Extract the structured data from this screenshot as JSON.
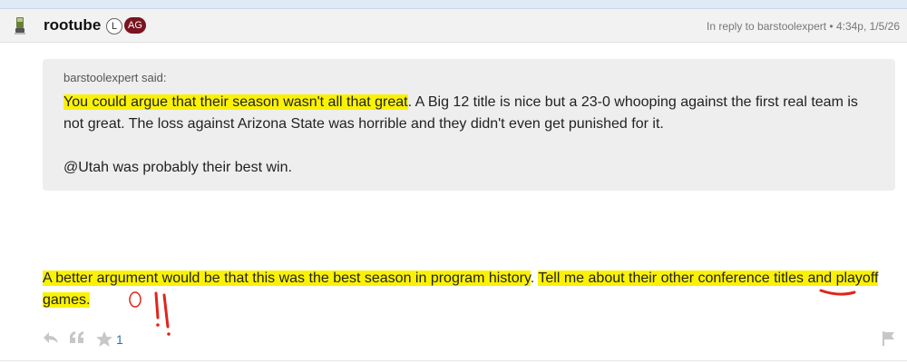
{
  "post": {
    "username": "rootube",
    "badges": [
      "L",
      "AG"
    ],
    "reply_meta": "In reply to barstoolexpert • 4:34p, 1/5/26",
    "quote": {
      "author_line": "barstoolexpert said:",
      "highlighted": "You could argue that their season wasn't all that great",
      "rest": ". A Big 12 title is nice but a 23-0 whooping against the first real team is not great. The loss against Arizona State was horrible and they didn't even get punished for it.",
      "p2": "@Utah was probably their best win."
    },
    "reply": {
      "hl1": "A better argument would be that this was the best season in program history",
      "mid": ". ",
      "hl2": "Tell me about their other conference titles and playoff games.",
      "after": ""
    },
    "like_count": "1",
    "annotation": "!!"
  },
  "icons": [
    "reply-icon",
    "quote-icon",
    "star-icon",
    "flag-icon",
    "avatar-icon"
  ],
  "colors": {
    "highlight": "#fbf203",
    "badge_ag": "#7a1420",
    "annotation": "#e0241b",
    "link": "#3a6ea5"
  }
}
